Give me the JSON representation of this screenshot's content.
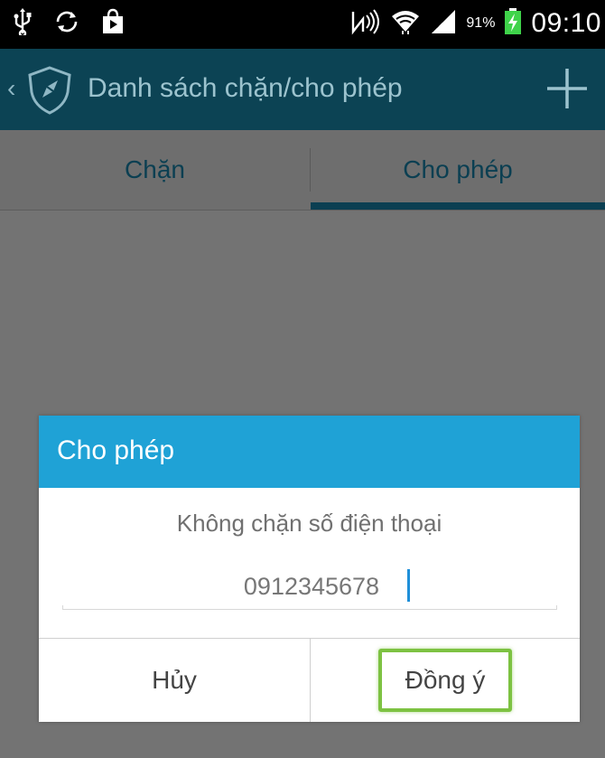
{
  "status_bar": {
    "battery_percent": "91%",
    "time": "09:10",
    "icons": [
      "usb-icon",
      "sync-icon",
      "store-icon",
      "nfc-icon",
      "wifi-icon",
      "signal-icon",
      "battery-charging-icon"
    ]
  },
  "app_bar": {
    "title": "Danh sách chặn/cho phép",
    "icons": [
      "back-chevron-icon",
      "shield-logo-icon",
      "add-icon"
    ]
  },
  "tabs": [
    {
      "label": "Chặn",
      "selected": false
    },
    {
      "label": "Cho phép",
      "selected": true
    }
  ],
  "dialog": {
    "title": "Cho phép",
    "message": "Không chặn số điện thoại",
    "phone_value": "0912345678",
    "cancel_label": "Hủy",
    "ok_label": "Đồng ý"
  },
  "colors": {
    "app_bar": "#0c4354",
    "dialog_header": "#1fa2d6",
    "highlight": "#7dc242",
    "overlay": "#737373"
  }
}
